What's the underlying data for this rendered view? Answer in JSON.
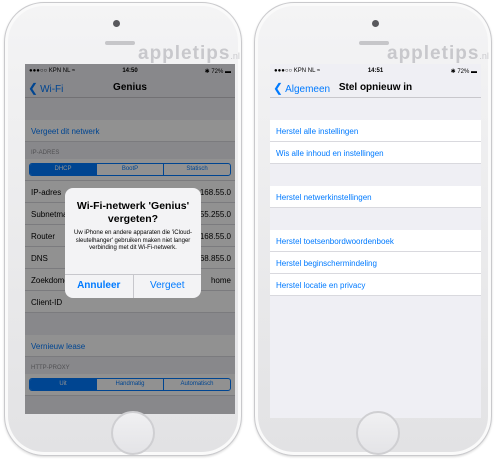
{
  "watermark": {
    "brand": "appletips",
    "tld": ".nl"
  },
  "left": {
    "status": {
      "carrier": "●●●○○ KPN NL ≈",
      "time": "14:50",
      "battery": "✱ 72% ▬"
    },
    "nav": {
      "back": "Wi-Fi",
      "title": "Genius"
    },
    "forget_network": "Vergeet dit netwerk",
    "ip_header": "IP-ADRES",
    "segments": [
      "DHCP",
      "BootP",
      "Statisch"
    ],
    "rows": [
      {
        "label": "IP-adres",
        "value": "192.168.55.0"
      },
      {
        "label": "Subnetmasker",
        "value": "255.255.255.0"
      },
      {
        "label": "Router",
        "value": "192.168.55.0"
      },
      {
        "label": "DNS",
        "value": "8.8.8.8, 192.168.855.0"
      },
      {
        "label": "Zoekdomeinen",
        "value": "home"
      },
      {
        "label": "Client-ID",
        "value": ""
      }
    ],
    "renew_lease": "Vernieuw lease",
    "proxy_header": "HTTP-PROXY",
    "proxy_segments": [
      "Uit",
      "Handmatig",
      "Automatisch"
    ],
    "alert": {
      "title": "Wi-Fi-netwerk 'Genius' vergeten?",
      "message": "Uw iPhone en andere apparaten die 'iCloud-sleutelhanger' gebruiken maken niet langer verbinding met dit Wi-Fi-netwerk.",
      "cancel": "Annuleer",
      "confirm": "Vergeet"
    }
  },
  "right": {
    "status": {
      "carrier": "●●●○○ KPN NL ≈",
      "time": "14:51",
      "battery": "✱ 72% ▬"
    },
    "nav": {
      "back": "Algemeen",
      "title": "Stel opnieuw in"
    },
    "group1": [
      "Herstel alle instellingen",
      "Wis alle inhoud en instellingen"
    ],
    "group2": [
      "Herstel netwerkinstellingen"
    ],
    "group3": [
      "Herstel toetsenbordwoordenboek",
      "Herstel beginschermindeling",
      "Herstel locatie en privacy"
    ]
  },
  "colors": {
    "accent": "#007aff",
    "background": "#efeff4",
    "overlay": "rgba(0,0,0,0.43)"
  },
  "icons": {
    "back": "chevron-left-icon",
    "home": "home-button-icon"
  }
}
